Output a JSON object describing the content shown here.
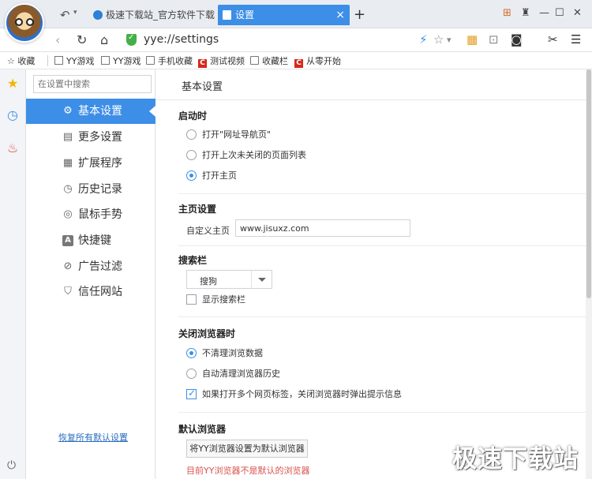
{
  "tabs": [
    {
      "title": "极速下载站_官方软件下载_I"
    },
    {
      "title": "设置"
    }
  ],
  "address": {
    "url": "yye://settings"
  },
  "bookmarks": [
    {
      "label": "收藏"
    },
    {
      "label": "YY游戏"
    },
    {
      "label": "YY游戏"
    },
    {
      "label": "手机收藏"
    },
    {
      "label": "测试视频"
    },
    {
      "label": "收藏栏"
    },
    {
      "label": "从零开始"
    }
  ],
  "sidebar": {
    "search_placeholder": "在设置中搜索",
    "items": [
      {
        "label": "基本设置",
        "icon": "gear-icon",
        "active": true
      },
      {
        "label": "更多设置",
        "icon": "list-icon"
      },
      {
        "label": "扩展程序",
        "icon": "grid-icon"
      },
      {
        "label": "历史记录",
        "icon": "clock-icon"
      },
      {
        "label": "鼠标手势",
        "icon": "gesture-icon"
      },
      {
        "label": "快捷键",
        "icon": "a-key-icon"
      },
      {
        "label": "广告过滤",
        "icon": "block-icon"
      },
      {
        "label": "信任网站",
        "icon": "shield-icon"
      }
    ],
    "restore_link": "恢复所有默认设置"
  },
  "main": {
    "title": "基本设置",
    "startup": {
      "title": "启动时",
      "options": [
        {
          "label": "打开\"网址导航页\"",
          "selected": false
        },
        {
          "label": "打开上次未关闭的页面列表",
          "selected": false
        },
        {
          "label": "打开主页",
          "selected": true
        }
      ]
    },
    "homepage": {
      "title": "主页设置",
      "label": "自定义主页",
      "value": "www.jisuxz.com"
    },
    "searchbar": {
      "title": "搜索栏",
      "engine": "搜狗",
      "show_label": "显示搜索栏",
      "show_checked": false
    },
    "close": {
      "title": "关闭浏览器时",
      "options": [
        {
          "label": "不清理浏览数据",
          "selected": true
        },
        {
          "label": "自动清理浏览器历史",
          "selected": false
        }
      ],
      "warn_label": "如果打开多个网页标签，关闭浏览器时弹出提示信息",
      "warn_checked": true
    },
    "default_browser": {
      "title": "默认浏览器",
      "button": "将YY浏览器设置为默认浏览器",
      "note": "目前YY浏览器不是默认的浏览器"
    }
  },
  "watermark": "极速下载站",
  "colors": {
    "accent": "#3d8ee6",
    "warning": "#d9534f",
    "link": "#2a6dc0"
  }
}
